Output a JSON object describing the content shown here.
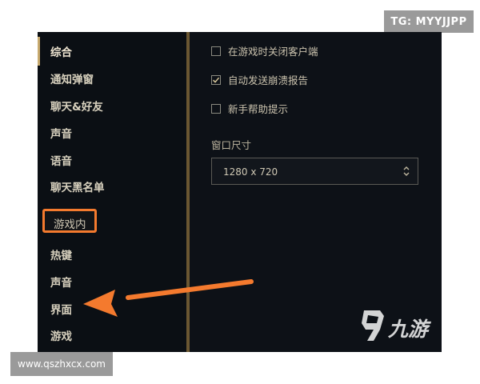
{
  "watermarks": {
    "top_right": "TG: MYYJJPP",
    "bottom_left": "www.qszhxcx.com",
    "logo": "九游"
  },
  "sidebar": {
    "items": [
      {
        "label": "综合",
        "active": true
      },
      {
        "label": "通知弹窗"
      },
      {
        "label": "聊天&好友"
      },
      {
        "label": "声音"
      },
      {
        "label": "语音"
      },
      {
        "label": "聊天黑名单"
      },
      {
        "label": "游戏内",
        "highlighted": true
      },
      {
        "label": "热键"
      },
      {
        "label": "声音"
      },
      {
        "label": "界面"
      },
      {
        "label": "游戏"
      }
    ]
  },
  "settings": {
    "checkboxes": [
      {
        "label": "在游戏时关闭客户端",
        "checked": false
      },
      {
        "label": "自动发送崩溃报告",
        "checked": true
      },
      {
        "label": "新手帮助提示",
        "checked": false
      }
    ],
    "window_size": {
      "label": "窗口尺寸",
      "value": "1280 x 720"
    }
  },
  "colors": {
    "accent_gold": "#c8aa6e",
    "highlight_orange": "#f47a2e",
    "background": "#0d1117"
  },
  "icons": {
    "checkmark": "check-icon",
    "select_arrows": "chevron-up-down-icon",
    "arrow": "arrow-left-icon"
  }
}
